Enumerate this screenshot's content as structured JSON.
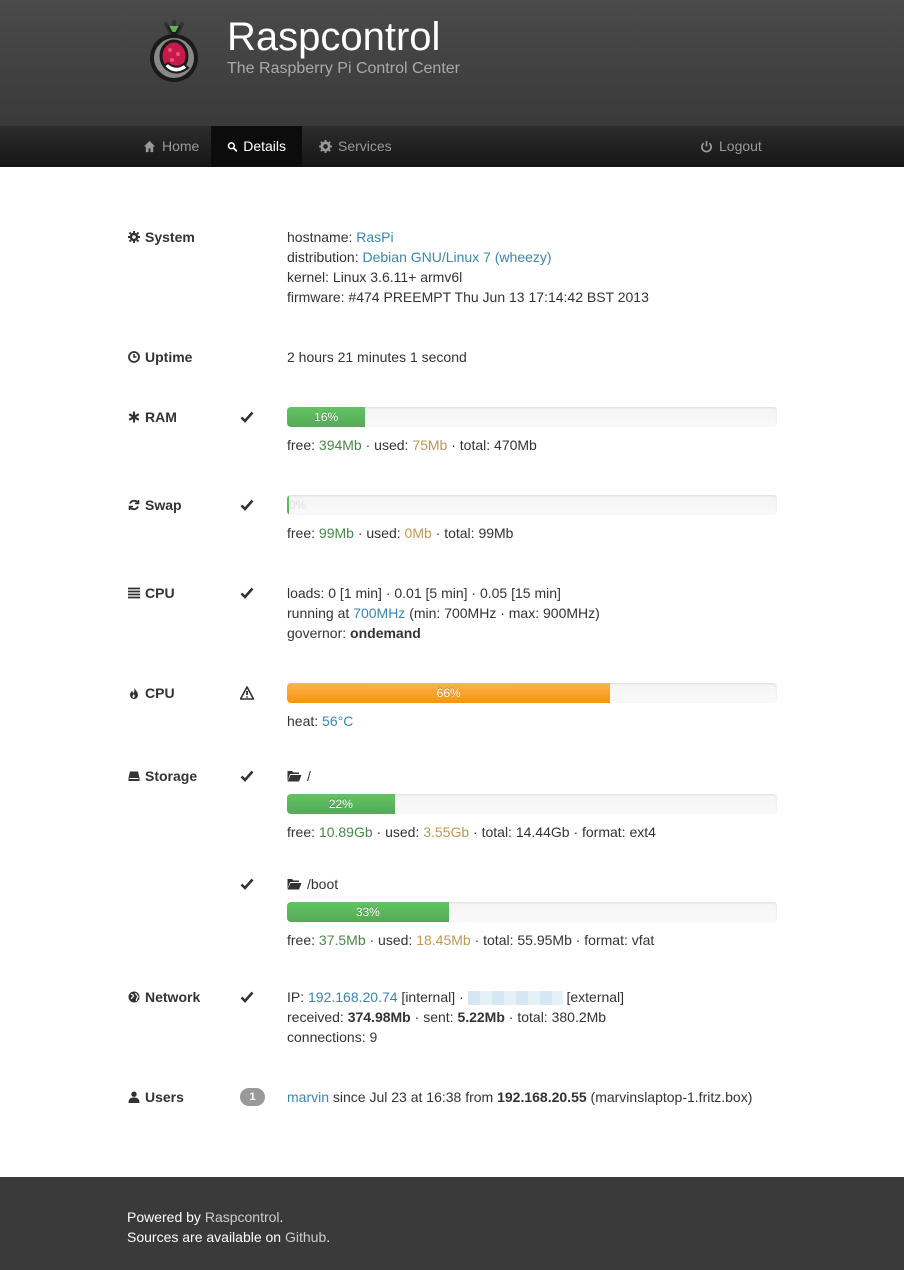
{
  "header": {
    "title": "Raspcontrol",
    "subtitle": "The Raspberry Pi Control Center"
  },
  "nav": {
    "items": [
      {
        "label": "Home",
        "icon": "home-icon",
        "active": false
      },
      {
        "label": "Details",
        "icon": "search-icon",
        "active": true
      },
      {
        "label": "Services",
        "icon": "gear-icon",
        "active": false
      }
    ],
    "logout": {
      "label": "Logout",
      "icon": "power-icon"
    }
  },
  "system": {
    "label": "System",
    "hostname_label": "hostname: ",
    "hostname": "RasPi",
    "distribution_label": "distribution: ",
    "distribution": "Debian GNU/Linux 7 (wheezy)",
    "kernel": "kernel: Linux 3.6.11+ armv6l",
    "firmware": "firmware: #474 PREEMPT Thu Jun 13 17:14:42 BST 2013"
  },
  "uptime": {
    "label": "Uptime",
    "value": "2 hours 21 minutes 1 second"
  },
  "ram": {
    "label": "RAM",
    "status": "ok",
    "percent": 16,
    "percent_label": "16%",
    "free_label": "free: ",
    "free": "394Mb",
    "used_label": " · used: ",
    "used": "75Mb",
    "total": " · total: 470Mb"
  },
  "swap": {
    "label": "Swap",
    "status": "ok",
    "percent": 0,
    "percent_label": "0%",
    "free_label": "free: ",
    "free": "99Mb",
    "used_label": " · used: ",
    "used": "0Mb",
    "total": " · total: 99Mb"
  },
  "cpu": {
    "label": "CPU",
    "status": "ok",
    "loads": "loads: 0 [1 min] · 0.01 [5 min] · 0.05 [15 min]",
    "running_label": "running at ",
    "running": "700MHz",
    "running_rest": " (min: 700MHz · max: 900MHz)",
    "governor_label": "governor: ",
    "governor": "ondemand"
  },
  "cpu_heat": {
    "label": "CPU",
    "status": "warning",
    "percent": 66,
    "percent_label": "66%",
    "heat_label": "heat: ",
    "heat": "56°C"
  },
  "storage": {
    "label": "Storage",
    "mounts": [
      {
        "status": "ok",
        "path": "/",
        "percent": 22,
        "percent_label": "22%",
        "free_label": "free: ",
        "free": "10.89Gb",
        "used_label": " · used: ",
        "used": "3.55Gb",
        "rest": " · total: 14.44Gb · format: ext4"
      },
      {
        "status": "ok",
        "path": "/boot",
        "percent": 33,
        "percent_label": "33%",
        "free_label": "free: ",
        "free": "37.5Mb",
        "used_label": " · used: ",
        "used": "18.45Mb",
        "rest": " · total: 55.95Mb · format: vfat"
      }
    ]
  },
  "network": {
    "label": "Network",
    "status": "ok",
    "ip_label": "IP: ",
    "ip": "192.168.20.74",
    "internal": " [internal] · ",
    "external": " [external]",
    "received_label": "received: ",
    "received": "374.98Mb",
    "sent_label": " · sent: ",
    "sent": "5.22Mb",
    "total": " · total: 380.2Mb",
    "connections": "connections: 9"
  },
  "users": {
    "label": "Users",
    "count": "1",
    "user": "marvin",
    "since": " since Jul 23 at 16:38 from ",
    "from_ip": "192.168.20.55",
    "host": " (marvinslaptop-1.fritz.box)"
  },
  "footer": {
    "powered_label": "Powered by ",
    "powered_link": "Raspcontrol",
    "powered_end": ".",
    "sources_label": "Sources are available on ",
    "sources_link": "Github",
    "sources_end": "."
  },
  "colors": {
    "link": "#3a87ad",
    "free": "#468847",
    "used": "#c09853",
    "bar_green": "#5eb95e",
    "bar_orange": "#f89406"
  }
}
